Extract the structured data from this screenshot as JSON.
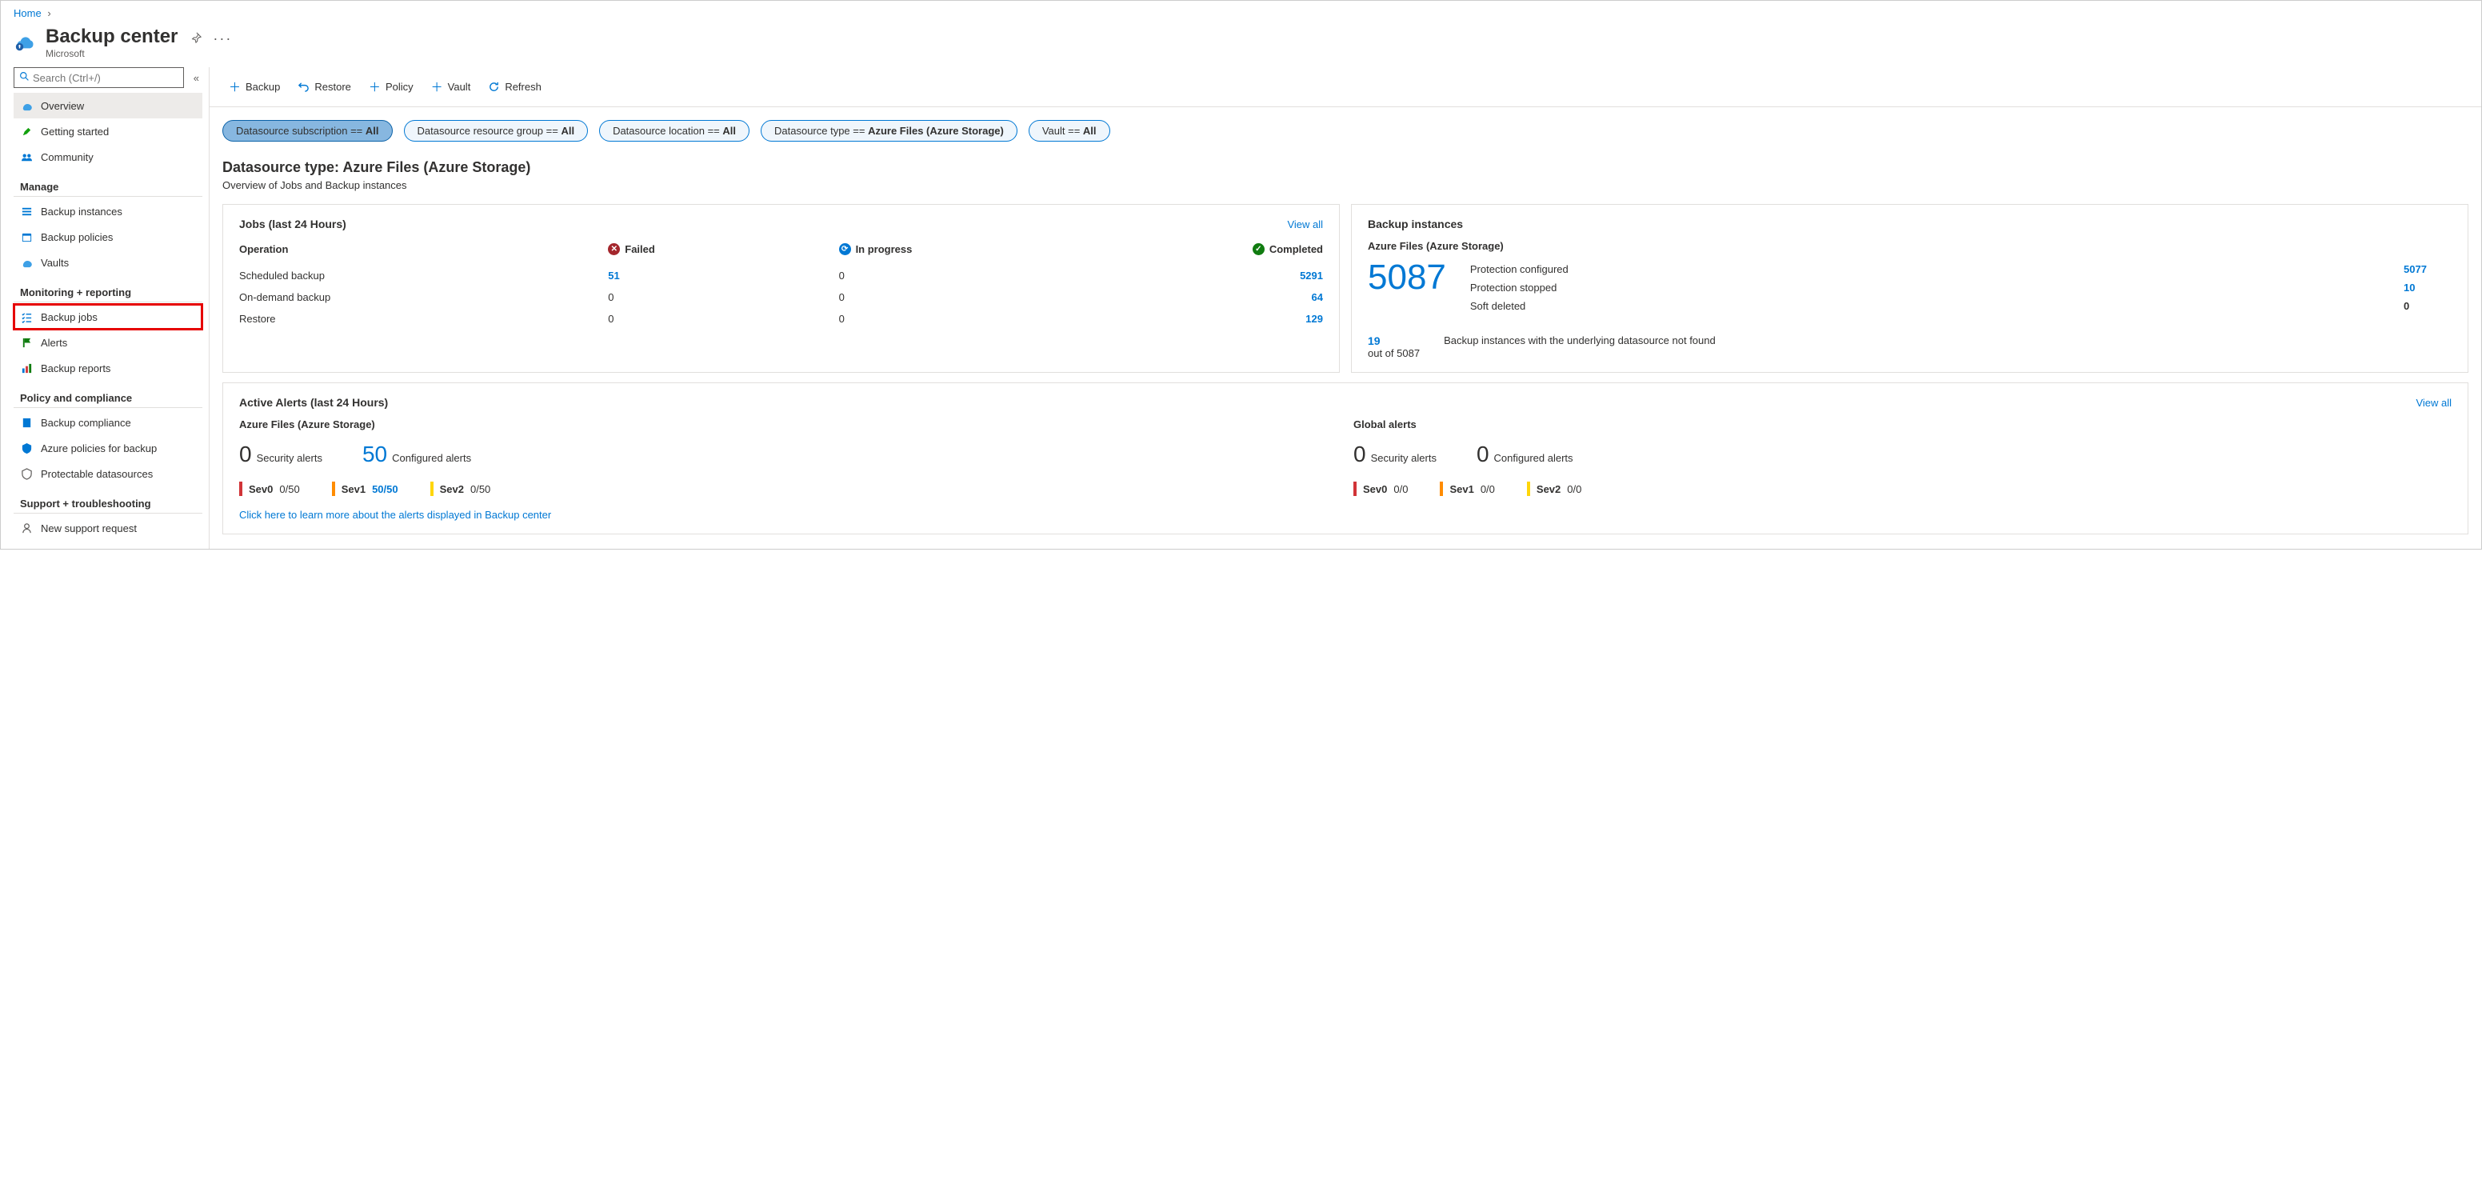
{
  "breadcrumb": {
    "home": "Home"
  },
  "header": {
    "title": "Backup center",
    "subtitle": "Microsoft"
  },
  "sidebar": {
    "search_placeholder": "Search (Ctrl+/)",
    "items_top": [
      {
        "label": "Overview"
      },
      {
        "label": "Getting started"
      },
      {
        "label": "Community"
      }
    ],
    "group_manage": "Manage",
    "items_manage": [
      {
        "label": "Backup instances"
      },
      {
        "label": "Backup policies"
      },
      {
        "label": "Vaults"
      }
    ],
    "group_monitoring": "Monitoring + reporting",
    "items_monitoring": [
      {
        "label": "Backup jobs"
      },
      {
        "label": "Alerts"
      },
      {
        "label": "Backup reports"
      }
    ],
    "group_policy": "Policy and compliance",
    "items_policy": [
      {
        "label": "Backup compliance"
      },
      {
        "label": "Azure policies for backup"
      },
      {
        "label": "Protectable datasources"
      }
    ],
    "group_support": "Support + troubleshooting",
    "items_support": [
      {
        "label": "New support request"
      }
    ]
  },
  "toolbar": {
    "backup": "Backup",
    "restore": "Restore",
    "policy": "Policy",
    "vault": "Vault",
    "refresh": "Refresh"
  },
  "filters": {
    "f1": {
      "label": "Datasource subscription == ",
      "value": "All"
    },
    "f2": {
      "label": "Datasource resource group == ",
      "value": "All"
    },
    "f3": {
      "label": "Datasource location == ",
      "value": "All"
    },
    "f4": {
      "label": "Datasource type == ",
      "value": "Azure Files (Azure Storage)"
    },
    "f5": {
      "label": "Vault == ",
      "value": "All"
    }
  },
  "ds": {
    "title": "Datasource type: Azure Files (Azure Storage)",
    "subtitle": "Overview of Jobs and Backup instances"
  },
  "jobs": {
    "title": "Jobs (last 24 Hours)",
    "view_all": "View all",
    "col_operation": "Operation",
    "col_failed": "Failed",
    "col_inprogress": "In progress",
    "col_completed": "Completed",
    "rows": [
      {
        "op": "Scheduled backup",
        "failed": "51",
        "inprogress": "0",
        "completed": "5291"
      },
      {
        "op": "On-demand backup",
        "failed": "0",
        "inprogress": "0",
        "completed": "64"
      },
      {
        "op": "Restore",
        "failed": "0",
        "inprogress": "0",
        "completed": "129"
      }
    ]
  },
  "instances": {
    "title": "Backup instances",
    "subtitle": "Azure Files (Azure Storage)",
    "total": "5087",
    "stats": [
      {
        "label": "Protection configured",
        "value": "5077"
      },
      {
        "label": "Protection stopped",
        "value": "10"
      },
      {
        "label": "Soft deleted",
        "value": "0"
      }
    ],
    "not_found_count": "19",
    "not_found_sub": "out of 5087",
    "not_found_text": "Backup instances with the underlying datasource not found"
  },
  "alerts": {
    "title": "Active Alerts (last 24 Hours)",
    "view_all": "View all",
    "left": {
      "heading": "Azure Files (Azure Storage)",
      "security_count": "0",
      "security_label": "Security alerts",
      "configured_count": "50",
      "configured_label": "Configured alerts",
      "sev0": {
        "name": "Sev0",
        "count": "0/50"
      },
      "sev1": {
        "name": "Sev1",
        "count": "50/50"
      },
      "sev2": {
        "name": "Sev2",
        "count": "0/50"
      }
    },
    "right": {
      "heading": "Global alerts",
      "security_count": "0",
      "security_label": "Security alerts",
      "configured_count": "0",
      "configured_label": "Configured alerts",
      "sev0": {
        "name": "Sev0",
        "count": "0/0"
      },
      "sev1": {
        "name": "Sev1",
        "count": "0/0"
      },
      "sev2": {
        "name": "Sev2",
        "count": "0/0"
      }
    },
    "footer_link": "Click here to learn more about the alerts displayed in Backup center"
  }
}
